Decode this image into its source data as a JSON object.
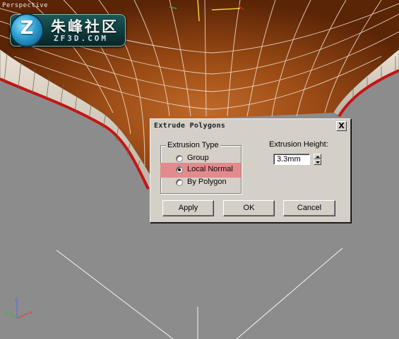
{
  "viewport": {
    "label": "Perspective",
    "logo": {
      "badge": "Z",
      "chinese": "朱峰社区",
      "domain": "ZF3D.COM"
    },
    "axes": {
      "x": "x",
      "y": "y",
      "z": "z"
    }
  },
  "dialog": {
    "title": "Extrude Polygons",
    "close_symbol": "X",
    "extrusion_type": {
      "heading": "Extrusion Type",
      "options": [
        {
          "label": "Group",
          "selected": false
        },
        {
          "label": "Local Normal",
          "selected": true
        },
        {
          "label": "By Polygon",
          "selected": false
        }
      ]
    },
    "extrusion_height": {
      "label": "Extrusion Height:",
      "value": "3.3mm"
    },
    "buttons": {
      "apply": "Apply",
      "ok": "OK",
      "cancel": "Cancel"
    }
  },
  "colors": {
    "viewport_bg": "#8c8c8c",
    "surface": "#9b4b15",
    "edge_red": "#c41414",
    "highlight": "#e4878a",
    "dialog_face": "#d4d0c8"
  }
}
